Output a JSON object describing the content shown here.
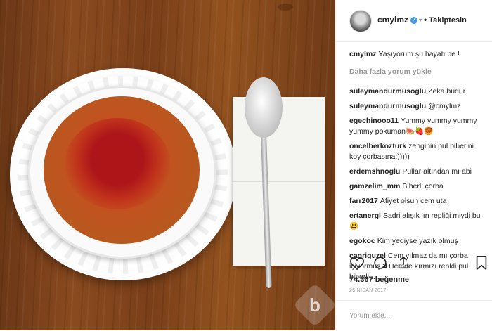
{
  "post": {
    "username": "cmylmz",
    "follow_label": "Takiptesin",
    "verified_icon": "check-badge-icon"
  },
  "comments": {
    "load_more": "Daha fazla yorum yükle",
    "items": [
      {
        "user": "cmylmz",
        "text": "Yaşıyorum şu hayatı be !"
      },
      {
        "user": "suleymandurmusoglu",
        "text": "Zeka budur"
      },
      {
        "user": "suleymandurmusoglu",
        "text": "@cmylmz"
      },
      {
        "user": "egechinooo11",
        "text": "Yummy yummy yummy yummy pokuman🍉🍓🥮"
      },
      {
        "user": "oncelberkozturk",
        "text": "zenginin pul biberini koy çorbasına:)))))"
      },
      {
        "user": "erdemshnoglu",
        "text": "Pullar altından mı abi"
      },
      {
        "user": "gamzelim_mm",
        "text": "Biberli çorba"
      },
      {
        "user": "farr2017",
        "text": "Afiyet olsun cem uta"
      },
      {
        "user": "ertanergl",
        "text": "Sadri alışık 'ın repliği miydi bu 😃"
      },
      {
        "user": "egokoc",
        "text": "Kim yediyse yazık olmuş"
      },
      {
        "user": "cagriguzel",
        "text": "Cem yılmaz da mı çorba içiyormuş ? Hemde kırmızı renkli pul biberli...."
      }
    ]
  },
  "stats": {
    "likes": "74.367 beğenme",
    "date": "25 NİSAN 2017"
  },
  "input": {
    "placeholder": "Yorum ekle..."
  },
  "icons": [
    "heart-icon",
    "comment-icon",
    "share-icon",
    "bookmark-icon"
  ],
  "colors": {
    "accent": "#3897f0",
    "muted": "#999999"
  }
}
